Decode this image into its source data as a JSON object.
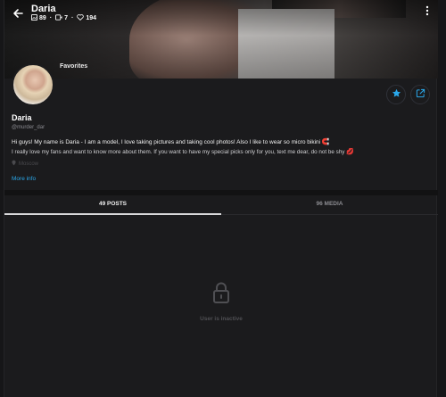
{
  "header": {
    "title": "Daria",
    "stats": {
      "posts": "89",
      "videos": "7",
      "likes": "194"
    }
  },
  "profile": {
    "list_label": "Favorites",
    "name": "Daria",
    "handle": "@murder_dar",
    "bio_line1": "Hi guys! My name is Daria - I am a model, I love taking pictures and taking cool photos! Also I like to wear so micro bikini",
    "bio_line2": "I really love my fans and want to know more about them. If you want to have my special picks only for you, text me dear, do not be shy",
    "location": "Moscow",
    "more_info": "More info"
  },
  "tabs": [
    {
      "label": "49 POSTS"
    },
    {
      "label": "96 MEDIA"
    }
  ],
  "content": {
    "empty_message": "User is inactive"
  },
  "colors": {
    "background": "#1b1b1d",
    "accent": "#2aa8ea",
    "fav_star": "#2aa8ea",
    "muted": "#8a8a90"
  },
  "icons": {
    "back": "arrow-left-icon",
    "posts": "image-icon",
    "videos": "video-icon",
    "likes": "heart-icon",
    "menu": "more-vertical-icon",
    "favorite": "star-icon",
    "share": "share-icon",
    "location": "location-pin-icon",
    "locked": "lock-icon"
  }
}
